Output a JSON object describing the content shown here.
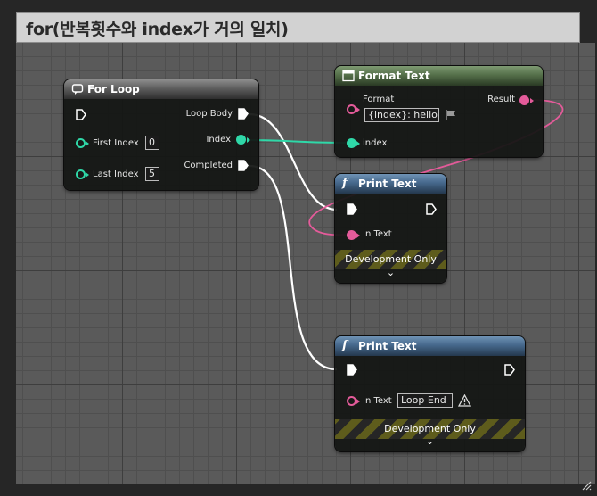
{
  "comment": {
    "title": "for(반복횟수와 index가 거의 일치)"
  },
  "for_loop": {
    "title": "For Loop",
    "pins": {
      "loop_body": "Loop Body",
      "index": "Index",
      "completed": "Completed",
      "first_index": "First Index",
      "last_index": "Last Index"
    },
    "first_index_value": "0",
    "last_index_value": "5"
  },
  "format_text": {
    "title": "Format Text",
    "format_label": "Format",
    "format_value": "{index}: hello",
    "result_label": "Result",
    "index_label": "index"
  },
  "print_text_1": {
    "title": "Print Text",
    "in_text_label": "In Text",
    "dev_only": "Development Only"
  },
  "print_text_2": {
    "title": "Print Text",
    "in_text_label": "In Text",
    "in_text_value": "Loop End",
    "dev_only": "Development Only"
  },
  "colors": {
    "exec_wire": "#ffffff",
    "int_wire": "#2fd8a8",
    "text_wire": "#e45b9a"
  }
}
